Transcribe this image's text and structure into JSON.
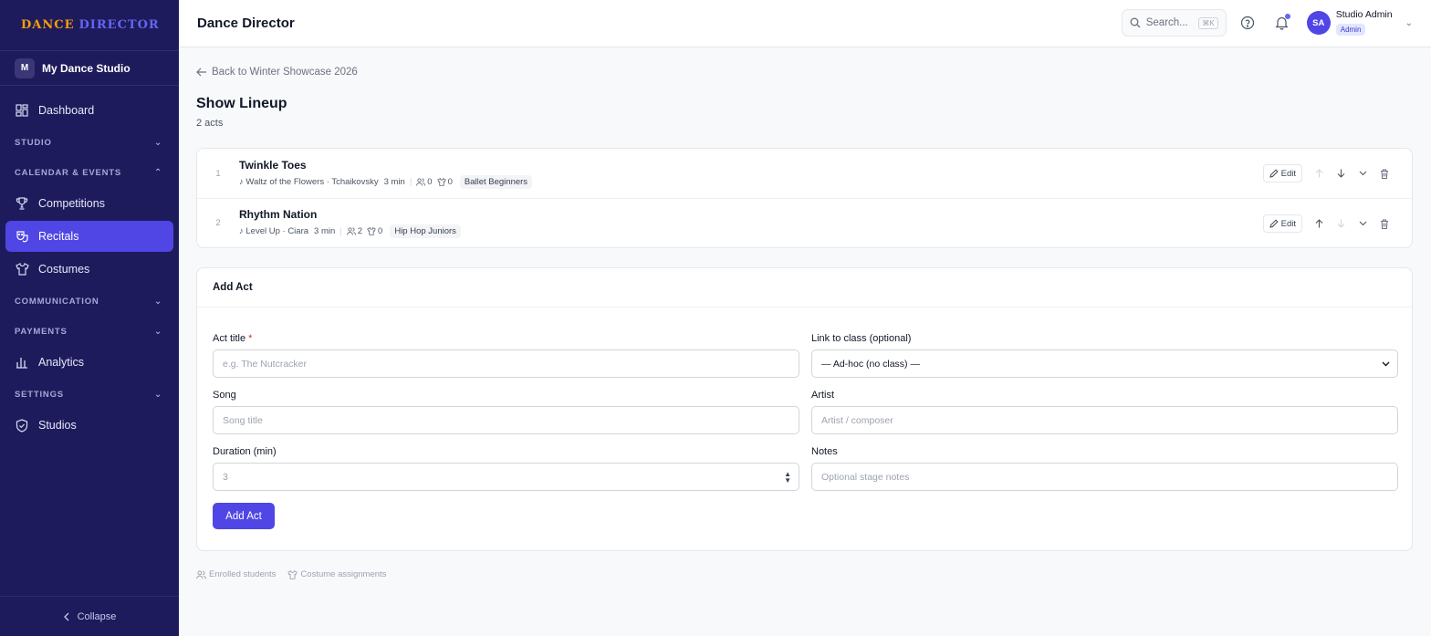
{
  "brand": {
    "word1": "DANCE",
    "word2": "DIRECTOR"
  },
  "studio": {
    "initial": "M",
    "name": "My Dance Studio"
  },
  "sidebar": {
    "dashboard": "Dashboard",
    "sections": {
      "studio": "STUDIO",
      "calendar": "CALENDAR & EVENTS",
      "communication": "COMMUNICATION",
      "payments": "PAYMENTS",
      "settings": "SETTINGS"
    },
    "competitions": "Competitions",
    "recitals": "Recitals",
    "costumes": "Costumes",
    "analytics": "Analytics",
    "studios": "Studios",
    "collapse": "Collapse"
  },
  "header": {
    "title": "Dance Director",
    "search_placeholder": "Search...",
    "search_shortcut": "⌘K",
    "user_initials": "SA",
    "user_name": "Studio Admin",
    "user_role": "Admin"
  },
  "main": {
    "back_link": "Back to Winter Showcase 2026",
    "title": "Show Lineup",
    "count": "2 acts",
    "acts": [
      {
        "num": "1",
        "title": "Twinkle Toes",
        "song": "♪ Waltz of the Flowers · Tchaikovsky",
        "duration": "3 min",
        "students": "0",
        "costumes": "0",
        "class": "Ballet Beginners",
        "edit": "Edit"
      },
      {
        "num": "2",
        "title": "Rhythm Nation",
        "song": "♪ Level Up · Ciara",
        "duration": "3 min",
        "students": "2",
        "costumes": "0",
        "class": "Hip Hop Juniors",
        "edit": "Edit"
      }
    ],
    "add_form": {
      "heading": "Add Act",
      "act_title_label": "Act title",
      "required_mark": "*",
      "act_title_placeholder": "e.g. The Nutcracker",
      "class_label": "Link to class (optional)",
      "class_value": "— Ad-hoc (no class) —",
      "song_label": "Song",
      "song_placeholder": "Song title",
      "artist_label": "Artist",
      "artist_placeholder": "Artist / composer",
      "duration_label": "Duration (min)",
      "duration_value": "3",
      "notes_label": "Notes",
      "notes_placeholder": "Optional stage notes",
      "submit": "Add Act"
    },
    "footer": {
      "enrolled": "Enrolled students",
      "costumes": "Costume assignments"
    }
  },
  "colors": {
    "sidebar": "#1e1b5c",
    "accent": "#4f46e5",
    "brand_orange": "#f59e0b"
  }
}
